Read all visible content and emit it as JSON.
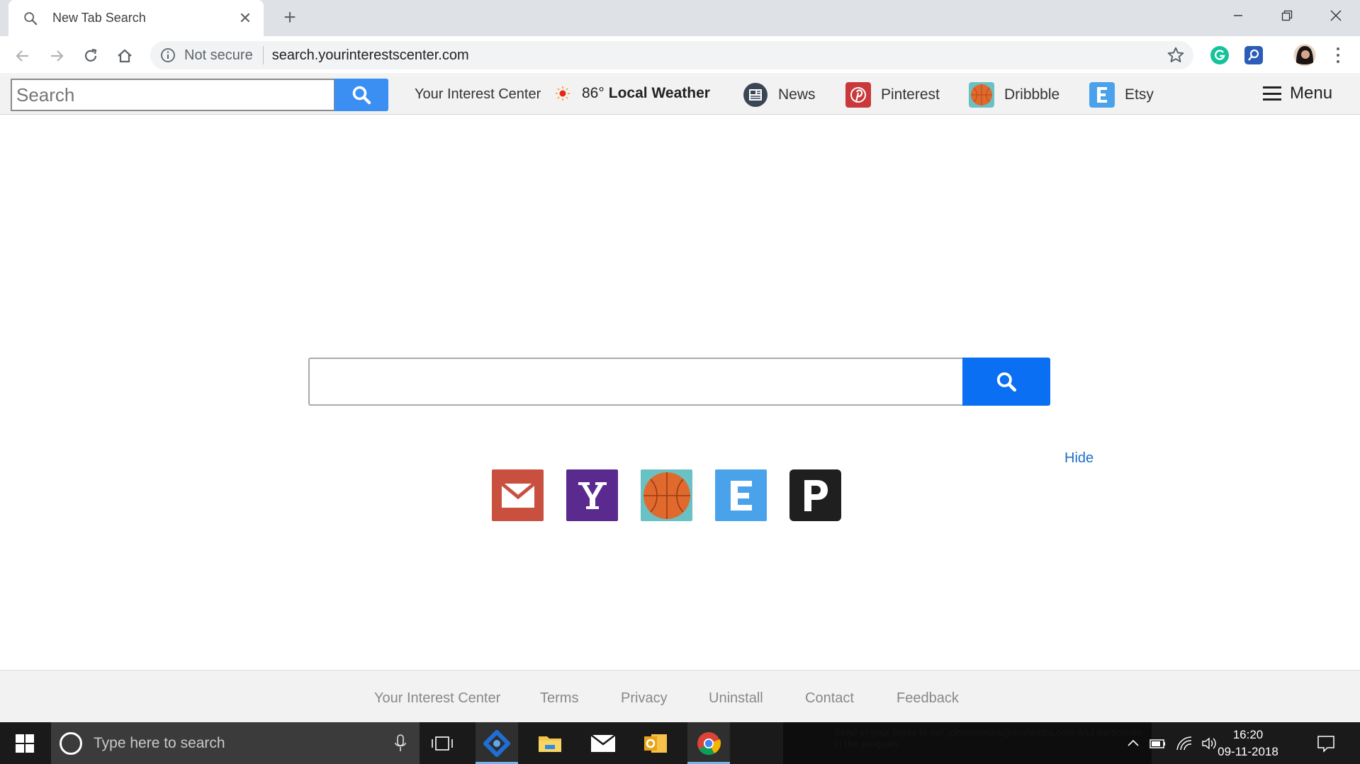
{
  "browser": {
    "tab_title": "New Tab Search",
    "tab_close": "✕",
    "new_tab": "+",
    "security_label": "Not secure",
    "url": "search.yourinterestscenter.com"
  },
  "site_header": {
    "search_placeholder": "Search",
    "brand": "Your Interest Center",
    "weather_temp": "86°",
    "weather_label": "Local Weather",
    "links": {
      "news": "News",
      "pinterest": "Pinterest",
      "dribbble": "Dribbble",
      "etsy": "Etsy"
    },
    "menu_label": "Menu"
  },
  "main": {
    "hide_label": "Hide",
    "tiles": [
      "gmail-tile",
      "yahoo-tile",
      "dribbble-tile",
      "etsy-tile",
      "pandora-tile"
    ]
  },
  "footer": {
    "links": [
      "Your Interest Center",
      "Terms",
      "Privacy",
      "Uninstall",
      "Contact",
      "Feedback"
    ]
  },
  "taskbar": {
    "search_placeholder": "Type here to search",
    "banner_text": "Send in your ideas to mil_ideanetwork@mahindra.com and participate in the program",
    "time": "16:20",
    "date": "09-11-2018"
  },
  "colors": {
    "accent_blue": "#0a6ff2",
    "header_btn": "#3b8ff2",
    "link_blue": "#1d6fc6",
    "gmail": "#c9503f",
    "yahoo": "#5b2a8e",
    "dribbble_bg": "#6ac1c4",
    "etsy": "#4aa3ea",
    "pandora": "#1f1f1f"
  }
}
